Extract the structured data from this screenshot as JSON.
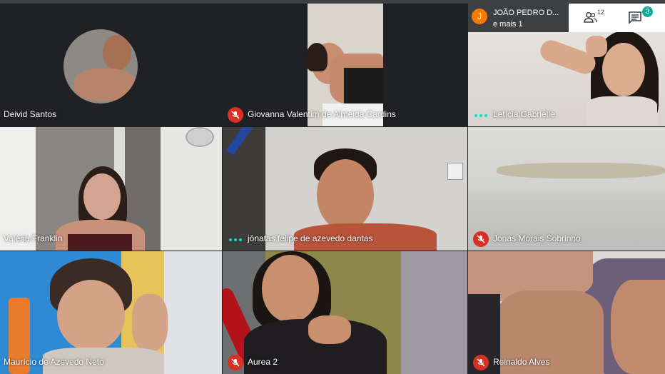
{
  "participants": [
    {
      "name": "Deivid Santos",
      "muted": false,
      "speaking": false
    },
    {
      "name": "Giovanna Valentim de Almeida Cardins",
      "muted": true,
      "speaking": false
    },
    {
      "name": "Letícia Gabrielle",
      "muted": false,
      "speaking": true
    },
    {
      "name": "Valéria Franklin",
      "muted": false,
      "speaking": false
    },
    {
      "name": "jônatas felipe de azevedo dantas",
      "muted": false,
      "speaking": true
    },
    {
      "name": "Jonas Morais Sobrinho",
      "muted": true,
      "speaking": false
    },
    {
      "name": "Maurício de Azevedo Neto",
      "muted": false,
      "speaking": false
    },
    {
      "name": "Aurea 2",
      "muted": true,
      "speaking": false
    },
    {
      "name": "Reinaldo Alves",
      "muted": true,
      "speaking": false
    }
  ],
  "presenter": {
    "avatar_letter": "J",
    "name": "JOÃO PEDRO D...",
    "others": "e mais 1",
    "avatar_color": "#f57c00"
  },
  "controls": {
    "people_count": "12",
    "chat_badge": "3",
    "people_icon": "people-icon",
    "chat_icon": "chat-icon"
  },
  "colors": {
    "muted_red": "#d93025",
    "speaking_teal": "#00e5c8",
    "badge_teal": "#12a99b"
  }
}
